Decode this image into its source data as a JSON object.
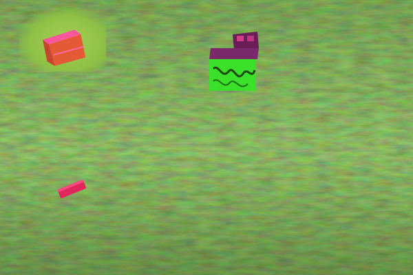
{
  "scene": {
    "description_colors": {
      "grass_dark": "#2f5316",
      "grass_mid": "#4f7c22",
      "grass_light": "#9fcf57",
      "patch": "#8fc145",
      "box1_red": "#e05a3a",
      "box1_pink_edge": "#ff5aa8",
      "box2_purple": "#7a2a6a",
      "box2_green": "#39e02a",
      "brick_pink": "#e0265a"
    },
    "objects": [
      {
        "name": "green-patch",
        "icon": "grass-patch"
      },
      {
        "name": "red-box",
        "icon": "box"
      },
      {
        "name": "purple-box",
        "icon": "box"
      },
      {
        "name": "pink-brick",
        "icon": "brick"
      }
    ]
  }
}
